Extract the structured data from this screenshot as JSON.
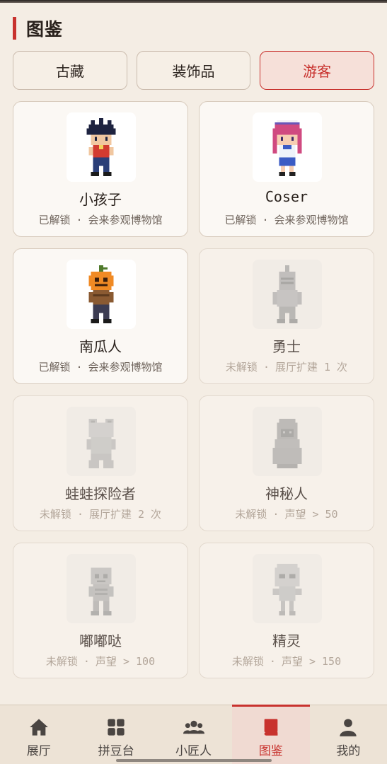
{
  "page": {
    "title": "图鉴"
  },
  "tabs": [
    {
      "label": "古藏",
      "active": false
    },
    {
      "label": "装饰品",
      "active": false
    },
    {
      "label": "游客",
      "active": true
    }
  ],
  "cards": [
    {
      "name": "小孩子",
      "status": "已解锁",
      "condition": "会来参观博物馆",
      "locked": false,
      "sprite": "boy-sprite"
    },
    {
      "name": "Coser",
      "status": "已解锁",
      "condition": "会来参观博物馆",
      "locked": false,
      "sprite": "coser-sprite"
    },
    {
      "name": "南瓜人",
      "status": "已解锁",
      "condition": "会来参观博物馆",
      "locked": false,
      "sprite": "pumpkin-sprite"
    },
    {
      "name": "勇士",
      "status": "未解锁",
      "condition": "展厅扩建 1 次",
      "locked": true,
      "sprite": "knight-sprite"
    },
    {
      "name": "蛙蛙探险者",
      "status": "未解锁",
      "condition": "展厅扩建 2 次",
      "locked": true,
      "sprite": "frog-sprite"
    },
    {
      "name": "神秘人",
      "status": "未解锁",
      "condition": "声望 > 50",
      "locked": true,
      "sprite": "hooded-sprite"
    },
    {
      "name": "嘟嘟哒",
      "status": "未解锁",
      "condition": "声望 > 100",
      "locked": true,
      "sprite": "robot-sprite"
    },
    {
      "name": "精灵",
      "status": "未解锁",
      "condition": "声望 > 150",
      "locked": true,
      "sprite": "spirit-sprite"
    }
  ],
  "nav": [
    {
      "label": "展厅",
      "icon": "home-icon",
      "active": false
    },
    {
      "label": "拼豆台",
      "icon": "grid-icon",
      "active": false
    },
    {
      "label": "小匠人",
      "icon": "people-icon",
      "active": false
    },
    {
      "label": "图鉴",
      "icon": "book-icon",
      "active": true
    },
    {
      "label": "我的",
      "icon": "user-icon",
      "active": false
    }
  ],
  "colors": {
    "accent": "#c8322e",
    "background": "#f4ede4",
    "card": "#fbf8f4"
  },
  "separator": "·"
}
